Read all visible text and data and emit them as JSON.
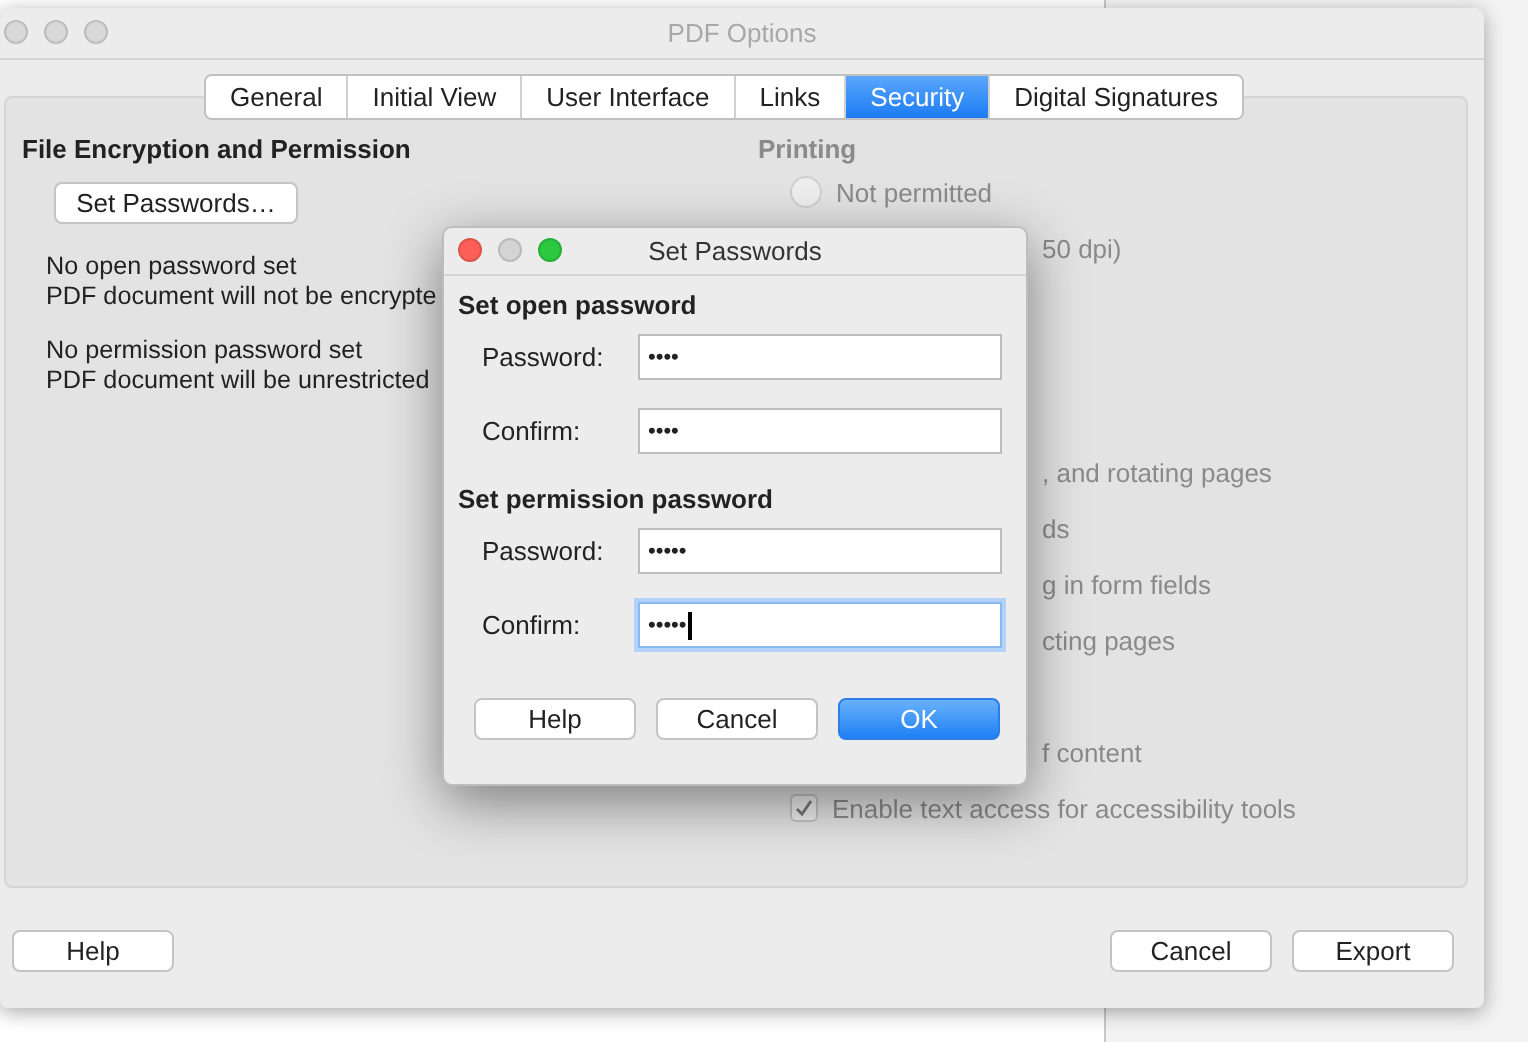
{
  "window": {
    "title": "PDF Options"
  },
  "tabs": [
    {
      "label": "General",
      "selected": false
    },
    {
      "label": "Initial View",
      "selected": false
    },
    {
      "label": "User Interface",
      "selected": false
    },
    {
      "label": "Links",
      "selected": false
    },
    {
      "label": "Security",
      "selected": true
    },
    {
      "label": "Digital Signatures",
      "selected": false
    }
  ],
  "encryption": {
    "heading": "File Encryption and Permission",
    "button": "Set Passwords…",
    "status": [
      {
        "line1": "No open password set",
        "line2": "PDF document will not be encrypte"
      },
      {
        "line1": "No permission password set",
        "line2": "PDF document will be unrestricted"
      }
    ]
  },
  "printing": {
    "heading": "Printing",
    "rows": [
      {
        "kind": "radio",
        "label": "Not permitted",
        "selected": false
      },
      {
        "kind": "fragment",
        "label": "50 dpi)"
      },
      {
        "kind": "blank"
      },
      {
        "kind": "blank"
      },
      {
        "kind": "blank"
      },
      {
        "kind": "fragment",
        "label": ", and rotating pages"
      },
      {
        "kind": "fragment",
        "label": "ds"
      },
      {
        "kind": "fragment",
        "label": "g in form fields"
      },
      {
        "kind": "fragment",
        "label": "cting pages"
      },
      {
        "kind": "blank"
      },
      {
        "kind": "fragment",
        "label": "f content"
      },
      {
        "kind": "checkbox",
        "label": "Enable text access for accessibility tools",
        "checked": true
      }
    ]
  },
  "buttons": {
    "help": "Help",
    "cancel": "Cancel",
    "export": "Export"
  },
  "dialog": {
    "title": "Set Passwords",
    "sections": [
      {
        "heading": "Set open password",
        "fields": [
          {
            "label": "Password:",
            "value": "••••",
            "focused": false
          },
          {
            "label": "Confirm:",
            "value": "••••",
            "focused": false
          }
        ]
      },
      {
        "heading": "Set permission password",
        "fields": [
          {
            "label": "Password:",
            "value": "•••••",
            "focused": false
          },
          {
            "label": "Confirm:",
            "value": "•••••",
            "focused": true
          }
        ]
      }
    ],
    "buttons": [
      {
        "label": "Help",
        "default": false
      },
      {
        "label": "Cancel",
        "default": false
      },
      {
        "label": "OK",
        "default": true
      }
    ]
  }
}
